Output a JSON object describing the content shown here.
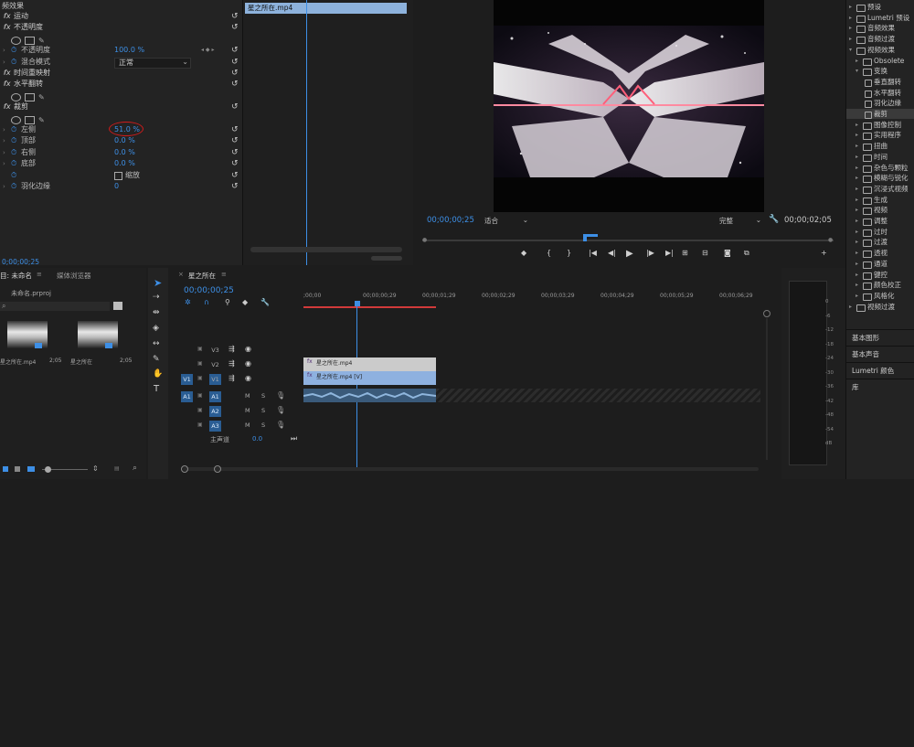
{
  "effect_controls": {
    "section_title": "频效果",
    "clip_tab": "星之所在.mp4",
    "timecode": "0;00;00;25",
    "rows": [
      {
        "kind": "fx",
        "label": "运动"
      },
      {
        "kind": "fx",
        "label": "不透明度"
      },
      {
        "kind": "shapes"
      },
      {
        "kind": "param",
        "label": "不透明度",
        "value": "100.0 %"
      },
      {
        "kind": "param",
        "label": "混合模式",
        "value": "正常",
        "dropdown": true
      },
      {
        "kind": "fx",
        "label": "时间重映射"
      },
      {
        "kind": "fx",
        "label": "水平翻转"
      },
      {
        "kind": "shapes"
      },
      {
        "kind": "fx",
        "label": "裁剪"
      },
      {
        "kind": "shapes"
      },
      {
        "kind": "param",
        "label": "左侧",
        "value": "51.0 %",
        "highlight": true
      },
      {
        "kind": "param",
        "label": "顶部",
        "value": "0.0 %"
      },
      {
        "kind": "param",
        "label": "右侧",
        "value": "0.0 %"
      },
      {
        "kind": "param",
        "label": "底部",
        "value": "0.0 %"
      },
      {
        "kind": "checkbox",
        "label": "缩放"
      },
      {
        "kind": "param",
        "label": "羽化边缘",
        "value": "0"
      }
    ]
  },
  "program_monitor": {
    "timecode": "00;00;00;25",
    "fit": "适合",
    "quality": "完整",
    "duration": "00;00;02;05",
    "transport_glyphs": [
      "◆",
      "{",
      "}",
      "|◀",
      "◀|",
      "▶",
      "|▶",
      "▶|",
      "⊞",
      "⊟",
      "◙",
      "⧉",
      "+"
    ]
  },
  "effects_browser": {
    "items": [
      {
        "label": "预设",
        "indent": 0,
        "open": false
      },
      {
        "label": "Lumetri 预设",
        "indent": 0,
        "open": false
      },
      {
        "label": "音频效果",
        "indent": 0,
        "open": false
      },
      {
        "label": "音频过渡",
        "indent": 0,
        "open": false
      },
      {
        "label": "视频效果",
        "indent": 0,
        "open": true
      },
      {
        "label": "Obsolete",
        "indent": 1,
        "open": false
      },
      {
        "label": "变换",
        "indent": 1,
        "open": true
      },
      {
        "label": "垂直翻转",
        "indent": 2,
        "leaf": true
      },
      {
        "label": "水平翻转",
        "indent": 2,
        "leaf": true
      },
      {
        "label": "羽化边缘",
        "indent": 2,
        "leaf": true
      },
      {
        "label": "裁剪",
        "indent": 2,
        "leaf": true,
        "selected": true
      },
      {
        "label": "图像控制",
        "indent": 1,
        "open": false
      },
      {
        "label": "实用程序",
        "indent": 1,
        "open": false
      },
      {
        "label": "扭曲",
        "indent": 1,
        "open": false
      },
      {
        "label": "时间",
        "indent": 1,
        "open": false
      },
      {
        "label": "杂色与颗粒",
        "indent": 1,
        "open": false
      },
      {
        "label": "模糊与锐化",
        "indent": 1,
        "open": false
      },
      {
        "label": "沉浸式视频",
        "indent": 1,
        "open": false
      },
      {
        "label": "生成",
        "indent": 1,
        "open": false
      },
      {
        "label": "视频",
        "indent": 1,
        "open": false
      },
      {
        "label": "调整",
        "indent": 1,
        "open": false
      },
      {
        "label": "过时",
        "indent": 1,
        "open": false
      },
      {
        "label": "过渡",
        "indent": 1,
        "open": false
      },
      {
        "label": "透视",
        "indent": 1,
        "open": false
      },
      {
        "label": "通道",
        "indent": 1,
        "open": false
      },
      {
        "label": "键控",
        "indent": 1,
        "open": false
      },
      {
        "label": "颜色校正",
        "indent": 1,
        "open": false
      },
      {
        "label": "风格化",
        "indent": 1,
        "open": false
      },
      {
        "label": "视频过渡",
        "indent": 0,
        "open": false
      }
    ],
    "panels": [
      "基本图形",
      "基本声音",
      "Lumetri 颜色",
      "库"
    ]
  },
  "project": {
    "tab_project": "目: 未命名",
    "tab_media": "媒体浏览器",
    "file": "未命名.prproj",
    "thumbs": [
      {
        "name": "星之所在.mp4",
        "dur": "2;05"
      },
      {
        "name": "星之所在",
        "dur": "2;05"
      }
    ]
  },
  "timeline": {
    "tab": "星之所在",
    "timecode": "00;00;00;25",
    "ruler": [
      ";00;00",
      "00;00;00;29",
      "00;00;01;29",
      "00;00;02;29",
      "00;00;03;29",
      "00;00;04;29",
      "00;00;05;29",
      "00;00;06;29"
    ],
    "tracks": [
      {
        "name": "V3",
        "src": "",
        "kind": "video"
      },
      {
        "name": "V2",
        "src": "",
        "kind": "video"
      },
      {
        "name": "V1",
        "src": "V1",
        "kind": "video"
      },
      {
        "name": "A1",
        "src": "A1",
        "kind": "audio"
      },
      {
        "name": "A2",
        "src": "",
        "kind": "audio"
      },
      {
        "name": "A3",
        "src": "",
        "kind": "audio"
      }
    ],
    "clip_v2": "星之所在.mp4",
    "clip_v1": "星之所在.mp4 [V]",
    "master_label": "主声道",
    "master_value": "0.0"
  },
  "meters": {
    "scale": [
      "0",
      "-6",
      "-12",
      "-18",
      "-24",
      "-30",
      "-36",
      "-42",
      "-48",
      "-54",
      "dB"
    ]
  }
}
